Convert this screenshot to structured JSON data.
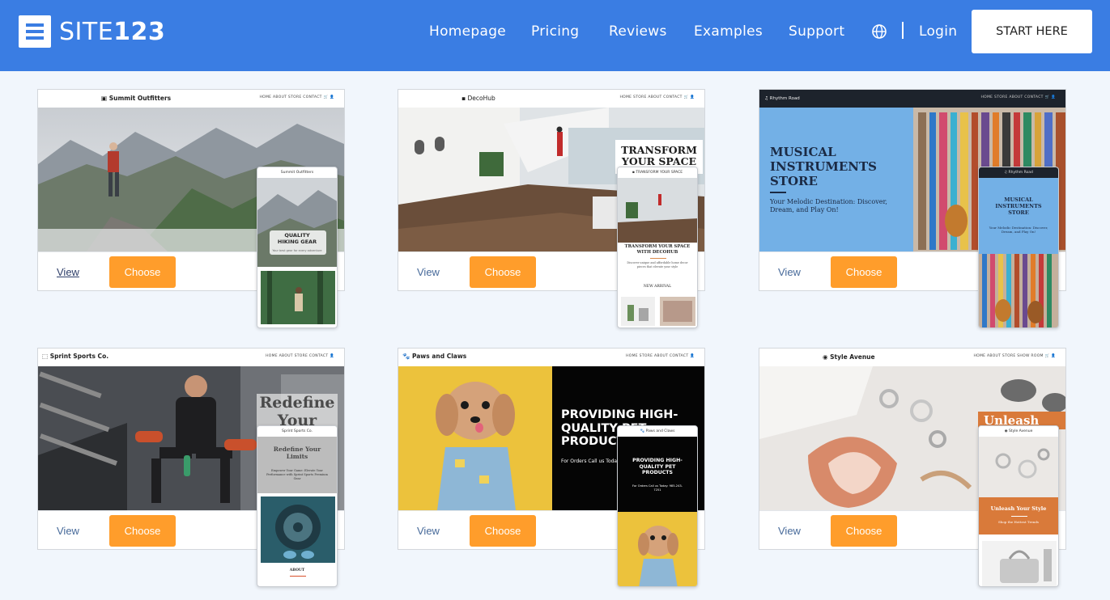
{
  "header": {
    "brand_light": "SITE",
    "brand_bold": "123",
    "nav": [
      "Homepage",
      "Pricing",
      "Reviews",
      "Examples",
      "Support"
    ],
    "login": "Login",
    "cta": "START HERE"
  },
  "colors": {
    "header_bg": "#3a7de3",
    "choose_bg": "#ff9d2b",
    "page_bg": "#f1f6fc"
  },
  "templates": [
    {
      "name": "Summit Outfitters",
      "links": "HOME  ABOUT  STORE  CONTACT  🛒 👤",
      "mobile_card_title": "QUALITY HIKING GEAR",
      "mobile_card_sub": "Your best gear for every adventure",
      "view": "View",
      "choose": "Choose"
    },
    {
      "name": "DecoHub",
      "links": "HOME   STORE   ABOUT   CONTACT  🛒 👤",
      "hero_title": "TRANSFORM YOUR SPACE",
      "mobile_hero": "TRANSFORM YOUR SPACE",
      "mobile_title": "TRANSFORM YOUR SPACE WITH DECOHUB",
      "mobile_body": "Discover unique and affordable home decor pieces that elevate your style",
      "mobile_section": "NEW ARRIVAL",
      "view": "View",
      "choose": "Choose"
    },
    {
      "name": "Rhythm Road",
      "links": "HOME   STORE   ABOUT   CONTACT  🛒 👤",
      "hero_title": "MUSICAL INSTRUMENTS STORE",
      "hero_sub": "Your Melodic Destination: Discover, Dream, and Play On!",
      "mobile_title": "MUSICAL INSTRUMENTS STORE",
      "mobile_sub": "Your Melodic Destination: Discover, Dream, and Play On!",
      "view": "View",
      "choose": "Choose"
    },
    {
      "name": "Sprint Sports Co.",
      "links": "HOME   ABOUT   STORE   CONTACT  👤",
      "hero_title": "Redefine Your",
      "mobile_title": "Redefine Your Limits",
      "mobile_body": "Empower Your Game: Elevate Your Performance with Sprint Sports Premium Gear",
      "mobile_section": "ABOUT",
      "view": "View",
      "choose": "Choose"
    },
    {
      "name": "Paws and Claws",
      "links": "HOME   STORE   ABOUT   CONTACT  👤",
      "hero_title": "PROVIDING HIGH-QUALITY PET PRODUCTS",
      "hero_sub": "For Orders Call us Today",
      "mobile_title": "PROVIDING HIGH-QUALITY PET PRODUCTS",
      "mobile_sub": "For Orders Call us Today: 985-243-7251",
      "view": "View",
      "choose": "Choose"
    },
    {
      "name": "Style Avenue",
      "links": "HOME   ABOUT   STORE   SHOW ROOM  🛒 👤",
      "hero_title": "Unleash",
      "mobile_title": "Unleash Your Style",
      "mobile_sub": "Shop the Hottest Trends",
      "view": "View",
      "choose": "Choose"
    }
  ]
}
